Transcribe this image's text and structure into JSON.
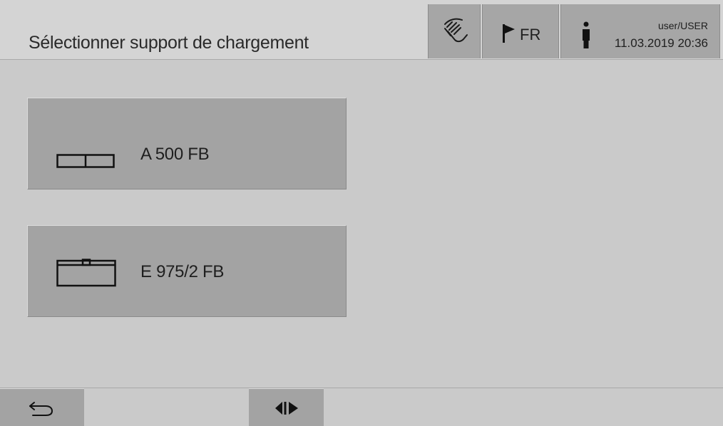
{
  "header": {
    "title": "Sélectionner support de chargement",
    "clean_button_icon": "hand-wipe-icon",
    "language": {
      "icon": "flag-icon",
      "label": "FR"
    },
    "user": {
      "icon": "person-icon",
      "name": "user/USER",
      "datetime": "11.03.2019 20:36"
    }
  },
  "racks": [
    {
      "label": "A 500 FB",
      "icon": "rack-double-icon"
    },
    {
      "label": "E 975/2 FB",
      "icon": "rack-tray-icon"
    }
  ],
  "footer": {
    "back_icon": "back-arrow-icon",
    "split_icon": "split-view-icon"
  },
  "colors": {
    "background": "#cacaca",
    "button": "#a3a3a3",
    "text": "#1f1f1f"
  }
}
